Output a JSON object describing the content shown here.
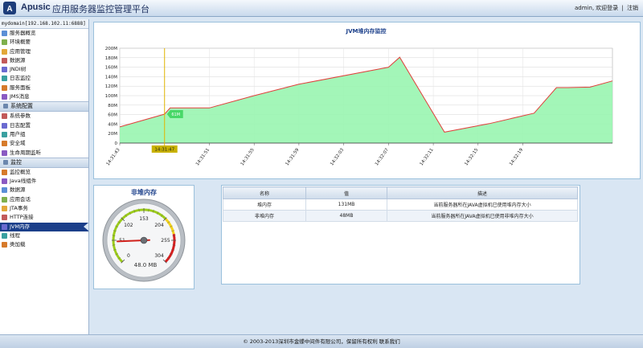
{
  "header": {
    "brand": "Apusic",
    "title": "应用服务器监控管理平台",
    "user": "admin",
    "welcome": "欢迎登录",
    "separator": "|",
    "logout": "注销"
  },
  "sidebar": {
    "domain": "mydomain[192.168.102.11:6888]",
    "groups": [
      {
        "label": "",
        "items": [
          "服务器概览",
          "环境概要",
          "应用管理",
          "数据源",
          "JNDI树",
          "日志监控",
          "服务面板",
          "JMS消息"
        ]
      },
      {
        "label": "系统配置",
        "items": [
          "系统参数",
          "日志配置",
          "用户组",
          "安全域",
          "生命周期监听"
        ]
      },
      {
        "label": "监控",
        "items": [
          "监控概览",
          "Java线组件",
          "数据源",
          "应用会话",
          "JTA事务",
          "HTTP连接",
          "JVM内存",
          "线程",
          "类加载"
        ]
      }
    ],
    "active_item": "JVM内存"
  },
  "chart": {
    "title": "JVM堆内存监控",
    "cursor_label": "61M",
    "cursor_time": "14:31:47",
    "colors": {
      "fill": "#99f5b0",
      "line": "#e0403c",
      "cursor": "#e0b400",
      "cursor_label_bg": "#48d868"
    }
  },
  "chart_data": {
    "type": "area",
    "title": "JVM堆内存监控",
    "xlabel": "",
    "ylabel": "",
    "ylim": [
      0,
      200
    ],
    "y_ticks": [
      "0",
      "20M",
      "40M",
      "60M",
      "80M",
      "100M",
      "120M",
      "140M",
      "160M",
      "180M",
      "200M"
    ],
    "x_ticks": [
      "14:31:43",
      "14:31:47",
      "14:31:51",
      "14:31:55",
      "14:31:59",
      "14:32:03",
      "14:32:07",
      "14:32:11",
      "14:32:15",
      "14:32:19"
    ],
    "x": [
      0,
      4,
      4.5,
      6,
      8,
      12,
      16,
      24,
      25,
      29,
      33,
      37,
      39,
      40,
      42,
      44
    ],
    "values": [
      34,
      61,
      74,
      74,
      74,
      100,
      124,
      160,
      181,
      23,
      41,
      63,
      117,
      117,
      118,
      131
    ],
    "grid": true
  },
  "gauge": {
    "title": "非堆内存",
    "value_text": "48.0 MB",
    "value": 48,
    "max": 304,
    "ticks": [
      "0",
      "51",
      "102",
      "153",
      "204",
      "255",
      "304"
    ],
    "colors": {
      "green": "#9ccc1a",
      "yellow": "#f2d21c",
      "red": "#d61f1f",
      "needle": "#d0211b"
    }
  },
  "table": {
    "headers": [
      "名称",
      "值",
      "描述"
    ],
    "rows": [
      [
        "堆内存",
        "131MB",
        "当前服务器所在JAVA虚拟机已使用堆内存大小"
      ],
      [
        "非堆内存",
        "48MB",
        "当前服务器所在JAVA虚拟机已使用非堆内存大小"
      ]
    ]
  },
  "footer": {
    "text": "© 2003-2013深圳市金蝶中间件有限公司，保留所有权利  联系我们"
  }
}
